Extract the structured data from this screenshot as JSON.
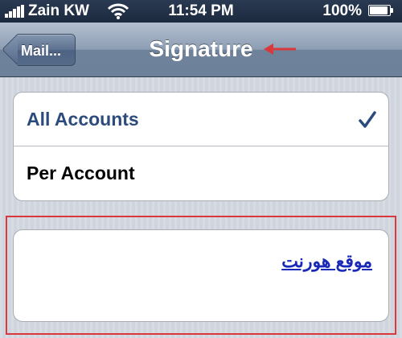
{
  "status_bar": {
    "carrier": "Zain KW",
    "time": "11:54 PM",
    "battery_percent": "100%",
    "battery_level": 1.0,
    "signal_bars": 5,
    "wifi_icon": "wifi-icon",
    "battery_icon": "battery-icon"
  },
  "nav_bar": {
    "back_label": "Mail...",
    "title": "Signature"
  },
  "accounts": {
    "items": [
      {
        "label": "All Accounts",
        "selected": true
      },
      {
        "label": "Per Account",
        "selected": false
      }
    ]
  },
  "signature": {
    "text": "موقع هورنت"
  },
  "colors": {
    "selected_text": "#2b4b7c",
    "link_text": "#1a29b8",
    "annotation": "#d9393d"
  }
}
